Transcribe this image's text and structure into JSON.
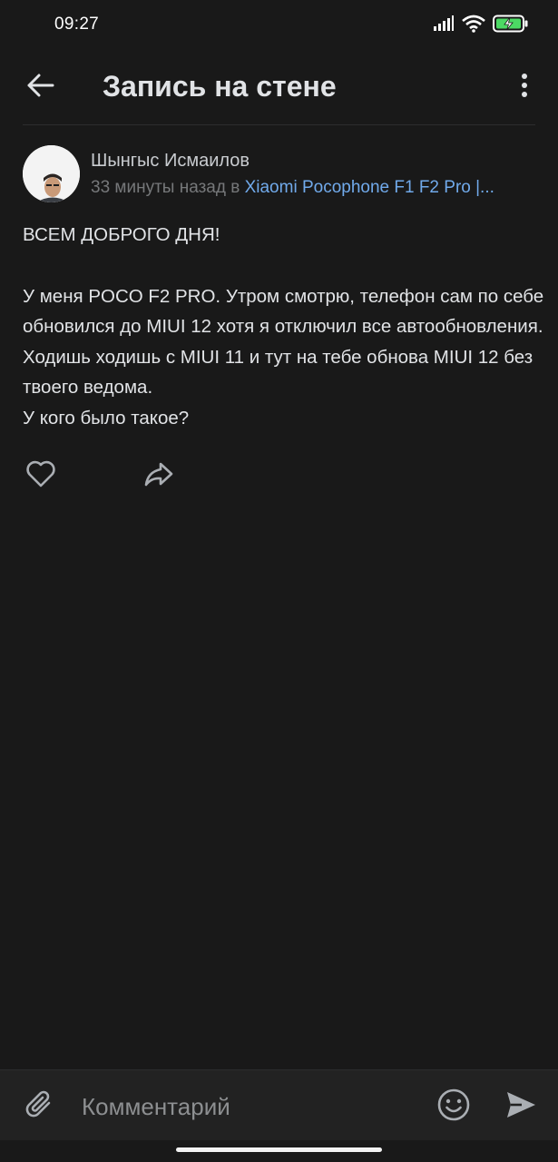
{
  "status_bar": {
    "time": "09:27",
    "icons": [
      "signal-icon",
      "wifi-icon",
      "battery-charging-icon"
    ]
  },
  "header": {
    "title": "Запись на стене",
    "back_icon": "arrow-left-icon",
    "more_icon": "more-vertical-icon"
  },
  "post": {
    "author": "Шынгыс Исмаилов",
    "time_text": "33 минуты назад в ",
    "community": "Xiaomi Pocophone F1 F2 Pro |...",
    "paragraphs": [
      "ВСЕМ ДОБРОГО ДНЯ!",
      "У меня POCO F2 PRO. Утром смотрю, телефон сам по себе обновился до MIUI 12 хотя я отключил все автообновления. Ходишь ходишь с MIUI 11 и тут на тебе обнова MIUI 12 без твоего ведома.",
      "У кого было такое?"
    ],
    "actions": [
      "heart-icon",
      "share-icon"
    ]
  },
  "comment_bar": {
    "placeholder": "Комментарий",
    "icons": [
      "paperclip-icon",
      "smile-icon",
      "send-icon"
    ]
  },
  "colors": {
    "background": "#191919",
    "text": "#e1e3e6",
    "secondary": "#76787a",
    "link": "#71aaeb",
    "icon": "#aaaeb3"
  }
}
